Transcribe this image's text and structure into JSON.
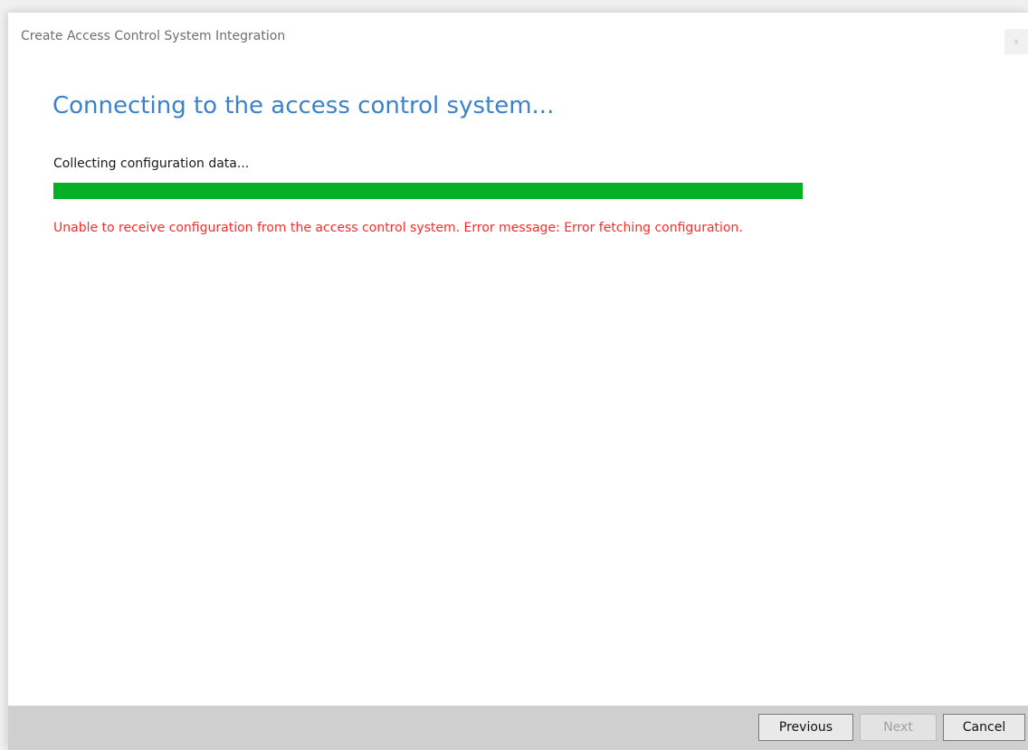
{
  "window": {
    "title": "Create Access Control System Integration",
    "close_label": "x"
  },
  "main": {
    "heading": "Connecting to the access control system...",
    "status": "Collecting configuration data...",
    "progress_fraction": 1.0,
    "progress_color": "#06b025",
    "error_message": "Unable to receive configuration from the access control system. Error message: Error fetching configuration.",
    "error_color": "#ff2a2a",
    "heading_color": "#3c82c8"
  },
  "footer": {
    "previous_label": "Previous",
    "next_label": "Next",
    "next_enabled": false,
    "cancel_label": "Cancel"
  }
}
